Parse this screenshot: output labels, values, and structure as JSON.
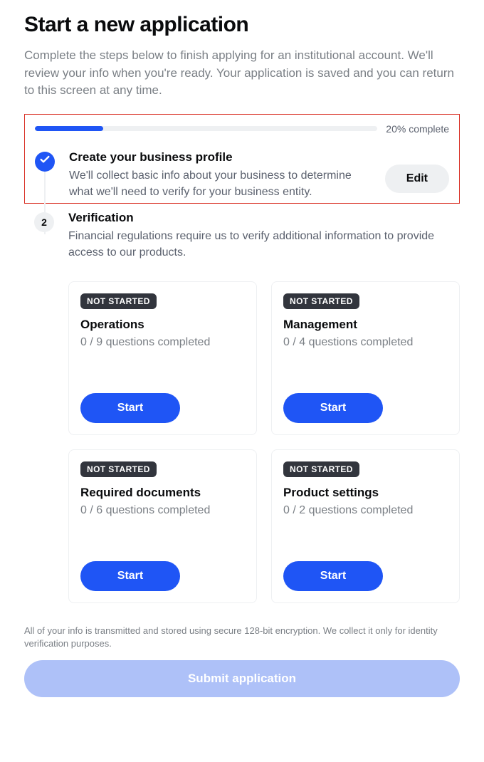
{
  "page": {
    "title": "Start a new application",
    "subtitle": "Complete the steps below to finish applying for an institutional account. We'll review your info when you're ready. Your application is saved and you can return to this screen at any time."
  },
  "progress": {
    "percent": 20,
    "label": "20% complete"
  },
  "step1": {
    "title": "Create your business profile",
    "desc": "We'll collect basic info about your business to determine what we'll need to verify for your business entity.",
    "edit_label": "Edit"
  },
  "step2": {
    "number": "2",
    "title": "Verification",
    "desc": "Financial regulations require us to verify additional information to provide access to our products."
  },
  "cards": [
    {
      "badge": "NOT STARTED",
      "title": "Operations",
      "sub": "0 / 9 questions completed",
      "action": "Start"
    },
    {
      "badge": "NOT STARTED",
      "title": "Management",
      "sub": "0 / 4 questions completed",
      "action": "Start"
    },
    {
      "badge": "NOT STARTED",
      "title": "Required documents",
      "sub": "0 / 6 questions completed",
      "action": "Start"
    },
    {
      "badge": "NOT STARTED",
      "title": "Product settings",
      "sub": "0 / 2 questions completed",
      "action": "Start"
    }
  ],
  "footer": {
    "disclaimer": "All of your info is transmitted and stored using secure 128-bit encryption. We collect it only for identity verification purposes.",
    "submit_label": "Submit application"
  }
}
